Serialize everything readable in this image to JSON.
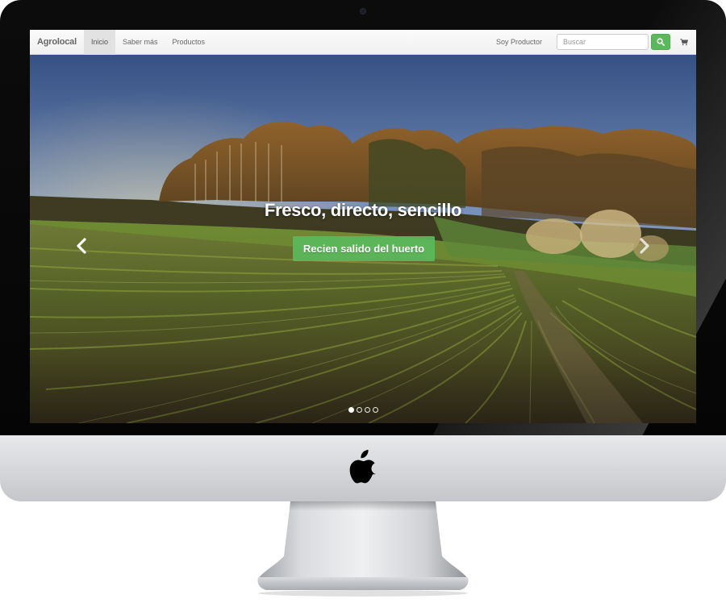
{
  "navbar": {
    "brand": "Agrolocal",
    "links": [
      {
        "label": "Inicio",
        "active": true
      },
      {
        "label": "Saber más",
        "active": false
      },
      {
        "label": "Productos",
        "active": false
      }
    ],
    "producer_link": "Soy Productor",
    "search_placeholder": "Buscar",
    "search_icon": "search-icon",
    "cart_icon": "shopping-cart-icon"
  },
  "carousel": {
    "caption_title": "Fresco, directo, sencillo",
    "cta_label": "Recien salido del huerto",
    "prev_icon": "chevron-left-icon",
    "next_icon": "chevron-right-icon",
    "slide_count": 4,
    "active_slide": 1
  },
  "colors": {
    "accent_green": "#5cb85c",
    "navbar_bg": "#f5f5f5",
    "active_nav_bg": "#e2e2e2"
  },
  "device": {
    "logo_icon": "apple-logo-icon"
  }
}
